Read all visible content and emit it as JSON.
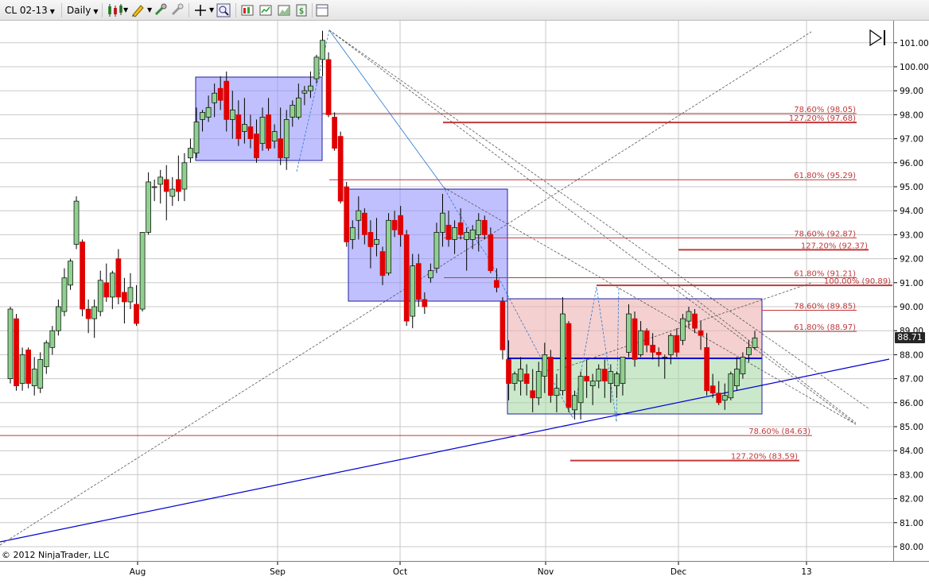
{
  "toolbar": {
    "instrument": "CL 02-13",
    "period": "Daily",
    "icons": [
      "candlestick-style-icon",
      "drawing-pencil-icon",
      "magnet-zoom-icon",
      "eraser-icon",
      "crosshair-icon",
      "zoom-icon",
      "data-box-icon",
      "chart-properties-icon",
      "strategy-icon",
      "template-icon"
    ]
  },
  "copyright": "© 2012 NinjaTrader, LLC",
  "last_price": "88.71",
  "colors": {
    "up_candle": "#8fd18f",
    "down_candle": "#e00000",
    "box_blue": "#8080ff",
    "box_red": "#f0a0a0",
    "box_green": "#a0d8a0",
    "fib_line": "#c0393b",
    "trend_blue": "#0000cc",
    "grid": "#c8c8c8"
  },
  "chart_data": {
    "type": "candlestick",
    "y_ticks": [
      "80.00",
      "81.00",
      "82.00",
      "83.00",
      "84.00",
      "85.00",
      "86.00",
      "87.00",
      "88.00",
      "89.00",
      "90.00",
      "91.00",
      "92.00",
      "93.00",
      "94.00",
      "95.00",
      "96.00",
      "97.00",
      "98.00",
      "99.00",
      "100.00",
      "101.00"
    ],
    "x_labels": [
      "Aug",
      "Sep",
      "Oct",
      "Nov",
      "Dec",
      "13"
    ],
    "ylim": [
      79.7,
      101.7
    ],
    "fib_labels": [
      {
        "text": "78.60% (98.05)",
        "price": 98.05
      },
      {
        "text": "127.20% (97.68)",
        "price": 97.68
      },
      {
        "text": "61.80% (95.29)",
        "price": 95.29
      },
      {
        "text": "78.60% (92.87)",
        "price": 92.87
      },
      {
        "text": "127.20% (92.37)",
        "price": 92.37
      },
      {
        "text": "61.80% (91.21)",
        "price": 91.21
      },
      {
        "text": "100.00% (90.89)",
        "price": 90.89
      },
      {
        "text": "78.60% (89.85)",
        "price": 89.85
      },
      {
        "text": "61.80% (88.97)",
        "price": 88.97
      },
      {
        "text": "78.60% (84.63)",
        "price": 84.63
      },
      {
        "text": "127.20% (83.59)",
        "price": 83.59
      }
    ],
    "candles": [
      {
        "o": 87.0,
        "h": 90.0,
        "l": 86.8,
        "c": 89.9
      },
      {
        "o": 89.5,
        "h": 89.7,
        "l": 86.5,
        "c": 86.7
      },
      {
        "o": 86.8,
        "h": 88.3,
        "l": 86.5,
        "c": 88.0
      },
      {
        "o": 88.2,
        "h": 88.3,
        "l": 86.6,
        "c": 86.8
      },
      {
        "o": 86.7,
        "h": 87.9,
        "l": 86.3,
        "c": 87.4
      },
      {
        "o": 86.6,
        "h": 88.1,
        "l": 86.4,
        "c": 87.8
      },
      {
        "o": 87.5,
        "h": 88.6,
        "l": 87.2,
        "c": 88.5
      },
      {
        "o": 88.3,
        "h": 89.2,
        "l": 88.0,
        "c": 89.0
      },
      {
        "o": 89.0,
        "h": 90.3,
        "l": 88.8,
        "c": 90.0
      },
      {
        "o": 89.8,
        "h": 91.6,
        "l": 89.6,
        "c": 91.2
      },
      {
        "o": 90.9,
        "h": 92.0,
        "l": 90.7,
        "c": 91.9
      },
      {
        "o": 92.6,
        "h": 94.6,
        "l": 92.4,
        "c": 94.4
      },
      {
        "o": 92.7,
        "h": 92.8,
        "l": 89.6,
        "c": 89.9
      },
      {
        "o": 89.9,
        "h": 90.3,
        "l": 88.9,
        "c": 89.5
      },
      {
        "o": 89.5,
        "h": 90.3,
        "l": 88.7,
        "c": 90.0
      },
      {
        "o": 89.8,
        "h": 91.5,
        "l": 89.6,
        "c": 91.1
      },
      {
        "o": 91.0,
        "h": 91.8,
        "l": 90.2,
        "c": 90.4
      },
      {
        "o": 90.4,
        "h": 91.5,
        "l": 89.9,
        "c": 91.4
      },
      {
        "o": 92.0,
        "h": 92.4,
        "l": 90.1,
        "c": 90.4
      },
      {
        "o": 90.6,
        "h": 91.2,
        "l": 89.3,
        "c": 90.2
      },
      {
        "o": 90.2,
        "h": 91.4,
        "l": 89.9,
        "c": 90.8
      },
      {
        "o": 90.1,
        "h": 90.9,
        "l": 89.2,
        "c": 89.3
      },
      {
        "o": 89.9,
        "h": 93.1,
        "l": 89.8,
        "c": 93.1
      },
      {
        "o": 93.1,
        "h": 95.6,
        "l": 93.0,
        "c": 95.2
      },
      {
        "o": 95.0,
        "h": 95.3,
        "l": 94.4,
        "c": 95.0
      },
      {
        "o": 95.1,
        "h": 95.7,
        "l": 94.3,
        "c": 95.4
      },
      {
        "o": 95.3,
        "h": 95.9,
        "l": 93.6,
        "c": 94.8
      },
      {
        "o": 94.6,
        "h": 95.4,
        "l": 94.2,
        "c": 94.9
      },
      {
        "o": 95.3,
        "h": 96.3,
        "l": 94.4,
        "c": 94.8
      },
      {
        "o": 94.9,
        "h": 96.4,
        "l": 94.4,
        "c": 96.0
      },
      {
        "o": 96.2,
        "h": 97.0,
        "l": 96.0,
        "c": 96.6
      },
      {
        "o": 96.4,
        "h": 98.3,
        "l": 96.2,
        "c": 97.7
      },
      {
        "o": 97.8,
        "h": 98.2,
        "l": 97.3,
        "c": 98.1
      },
      {
        "o": 97.9,
        "h": 98.8,
        "l": 97.7,
        "c": 98.3
      },
      {
        "o": 98.5,
        "h": 99.3,
        "l": 97.9,
        "c": 98.9
      },
      {
        "o": 99.1,
        "h": 99.6,
        "l": 98.2,
        "c": 98.6
      },
      {
        "o": 99.4,
        "h": 99.8,
        "l": 97.3,
        "c": 97.8
      },
      {
        "o": 97.8,
        "h": 99.0,
        "l": 97.0,
        "c": 98.2
      },
      {
        "o": 98.0,
        "h": 98.6,
        "l": 96.7,
        "c": 97.0
      },
      {
        "o": 97.3,
        "h": 98.7,
        "l": 96.8,
        "c": 97.6
      },
      {
        "o": 97.5,
        "h": 98.0,
        "l": 96.6,
        "c": 97.0
      },
      {
        "o": 97.2,
        "h": 97.8,
        "l": 96.0,
        "c": 96.2
      },
      {
        "o": 96.8,
        "h": 98.3,
        "l": 96.5,
        "c": 97.9
      },
      {
        "o": 98.0,
        "h": 98.7,
        "l": 96.5,
        "c": 96.6
      },
      {
        "o": 96.9,
        "h": 97.6,
        "l": 96.6,
        "c": 97.3
      },
      {
        "o": 97.0,
        "h": 98.3,
        "l": 95.9,
        "c": 96.2
      },
      {
        "o": 96.2,
        "h": 98.2,
        "l": 95.7,
        "c": 97.8
      },
      {
        "o": 97.9,
        "h": 98.6,
        "l": 97.5,
        "c": 98.4
      },
      {
        "o": 97.9,
        "h": 99.3,
        "l": 97.8,
        "c": 98.7
      },
      {
        "o": 98.9,
        "h": 99.2,
        "l": 98.4,
        "c": 99.0
      },
      {
        "o": 99.0,
        "h": 99.8,
        "l": 98.7,
        "c": 99.2
      },
      {
        "o": 99.5,
        "h": 100.5,
        "l": 99.3,
        "c": 100.4
      },
      {
        "o": 100.3,
        "h": 101.5,
        "l": 99.6,
        "c": 101.1
      },
      {
        "o": 100.3,
        "h": 100.6,
        "l": 97.9,
        "c": 98.0
      },
      {
        "o": 97.9,
        "h": 98.1,
        "l": 96.5,
        "c": 96.6
      },
      {
        "o": 97.1,
        "h": 97.3,
        "l": 94.3,
        "c": 94.4
      },
      {
        "o": 95.0,
        "h": 95.2,
        "l": 92.5,
        "c": 92.7
      },
      {
        "o": 92.8,
        "h": 93.6,
        "l": 92.4,
        "c": 93.3
      },
      {
        "o": 93.6,
        "h": 94.6,
        "l": 92.8,
        "c": 94.0
      },
      {
        "o": 93.9,
        "h": 94.1,
        "l": 92.6,
        "c": 93.0
      },
      {
        "o": 93.1,
        "h": 93.6,
        "l": 91.6,
        "c": 92.5
      },
      {
        "o": 92.6,
        "h": 93.7,
        "l": 92.1,
        "c": 92.8
      },
      {
        "o": 92.3,
        "h": 92.5,
        "l": 90.9,
        "c": 91.3
      },
      {
        "o": 91.4,
        "h": 93.9,
        "l": 91.3,
        "c": 93.6
      },
      {
        "o": 93.6,
        "h": 94.0,
        "l": 92.9,
        "c": 93.2
      },
      {
        "o": 93.8,
        "h": 94.2,
        "l": 92.5,
        "c": 93.0
      },
      {
        "o": 93.0,
        "h": 93.2,
        "l": 89.2,
        "c": 89.4
      },
      {
        "o": 89.6,
        "h": 92.2,
        "l": 89.1,
        "c": 91.7
      },
      {
        "o": 91.8,
        "h": 92.2,
        "l": 90.0,
        "c": 90.3
      },
      {
        "o": 90.3,
        "h": 90.6,
        "l": 89.7,
        "c": 90.0
      },
      {
        "o": 91.2,
        "h": 91.8,
        "l": 91.0,
        "c": 91.5
      },
      {
        "o": 91.6,
        "h": 93.5,
        "l": 91.4,
        "c": 93.1
      },
      {
        "o": 93.1,
        "h": 94.7,
        "l": 92.5,
        "c": 93.9
      },
      {
        "o": 93.4,
        "h": 94.0,
        "l": 92.5,
        "c": 92.8
      },
      {
        "o": 92.8,
        "h": 93.6,
        "l": 92.2,
        "c": 93.3
      },
      {
        "o": 93.5,
        "h": 94.1,
        "l": 92.8,
        "c": 93.0
      },
      {
        "o": 92.8,
        "h": 93.3,
        "l": 91.5,
        "c": 93.1
      },
      {
        "o": 92.8,
        "h": 93.4,
        "l": 92.4,
        "c": 93.2
      },
      {
        "o": 93.0,
        "h": 93.9,
        "l": 92.3,
        "c": 93.6
      },
      {
        "o": 93.6,
        "h": 93.8,
        "l": 92.8,
        "c": 93.0
      },
      {
        "o": 93.0,
        "h": 93.3,
        "l": 91.4,
        "c": 91.5
      },
      {
        "o": 91.1,
        "h": 91.6,
        "l": 90.6,
        "c": 90.8
      },
      {
        "o": 90.2,
        "h": 90.4,
        "l": 87.8,
        "c": 88.2
      },
      {
        "o": 87.8,
        "h": 88.6,
        "l": 86.1,
        "c": 86.8
      },
      {
        "o": 86.8,
        "h": 87.3,
        "l": 86.5,
        "c": 87.2
      },
      {
        "o": 86.9,
        "h": 87.9,
        "l": 86.3,
        "c": 87.4
      },
      {
        "o": 87.2,
        "h": 87.6,
        "l": 86.3,
        "c": 86.8
      },
      {
        "o": 86.5,
        "h": 87.4,
        "l": 85.6,
        "c": 86.2
      },
      {
        "o": 86.2,
        "h": 87.7,
        "l": 85.9,
        "c": 87.3
      },
      {
        "o": 87.1,
        "h": 88.5,
        "l": 86.4,
        "c": 88.0
      },
      {
        "o": 87.9,
        "h": 88.2,
        "l": 86.0,
        "c": 86.3
      },
      {
        "o": 86.3,
        "h": 87.2,
        "l": 85.6,
        "c": 86.6
      },
      {
        "o": 86.5,
        "h": 90.4,
        "l": 86.3,
        "c": 89.7
      },
      {
        "o": 89.3,
        "h": 89.4,
        "l": 85.6,
        "c": 85.8
      },
      {
        "o": 85.7,
        "h": 86.5,
        "l": 85.3,
        "c": 86.3
      },
      {
        "o": 86.0,
        "h": 87.3,
        "l": 85.3,
        "c": 87.1
      },
      {
        "o": 87.1,
        "h": 87.8,
        "l": 86.2,
        "c": 86.9
      },
      {
        "o": 86.7,
        "h": 87.2,
        "l": 85.9,
        "c": 86.9
      },
      {
        "o": 86.9,
        "h": 87.6,
        "l": 86.6,
        "c": 87.4
      },
      {
        "o": 87.4,
        "h": 87.8,
        "l": 86.2,
        "c": 86.9
      },
      {
        "o": 86.8,
        "h": 87.6,
        "l": 86.0,
        "c": 87.3
      },
      {
        "o": 86.7,
        "h": 87.3,
        "l": 86.2,
        "c": 87.2
      },
      {
        "o": 86.8,
        "h": 87.7,
        "l": 86.3,
        "c": 87.9
      },
      {
        "o": 88.1,
        "h": 90.1,
        "l": 87.9,
        "c": 89.7
      },
      {
        "o": 89.5,
        "h": 89.8,
        "l": 87.5,
        "c": 87.8
      },
      {
        "o": 88.0,
        "h": 89.4,
        "l": 87.9,
        "c": 89.0
      },
      {
        "o": 89.0,
        "h": 89.1,
        "l": 88.1,
        "c": 88.4
      },
      {
        "o": 88.4,
        "h": 88.9,
        "l": 87.8,
        "c": 88.1
      },
      {
        "o": 88.1,
        "h": 88.3,
        "l": 87.5,
        "c": 88.0
      },
      {
        "o": 87.9,
        "h": 88.0,
        "l": 87.0,
        "c": 87.9
      },
      {
        "o": 88.0,
        "h": 88.9,
        "l": 87.6,
        "c": 88.8
      },
      {
        "o": 88.8,
        "h": 89.1,
        "l": 87.9,
        "c": 88.1
      },
      {
        "o": 88.6,
        "h": 89.7,
        "l": 88.4,
        "c": 89.5
      },
      {
        "o": 89.4,
        "h": 90.0,
        "l": 89.1,
        "c": 89.8
      },
      {
        "o": 89.7,
        "h": 89.9,
        "l": 88.9,
        "c": 89.1
      },
      {
        "o": 89.0,
        "h": 89.4,
        "l": 88.2,
        "c": 88.8
      },
      {
        "o": 88.3,
        "h": 88.9,
        "l": 86.3,
        "c": 86.5
      },
      {
        "o": 86.7,
        "h": 87.2,
        "l": 86.2,
        "c": 86.4
      },
      {
        "o": 86.4,
        "h": 86.9,
        "l": 85.9,
        "c": 86.0
      },
      {
        "o": 86.1,
        "h": 86.8,
        "l": 85.7,
        "c": 86.3
      },
      {
        "o": 86.2,
        "h": 87.3,
        "l": 86.1,
        "c": 87.2
      },
      {
        "o": 86.7,
        "h": 87.9,
        "l": 86.5,
        "c": 87.4
      },
      {
        "o": 87.2,
        "h": 88.1,
        "l": 87.0,
        "c": 87.9
      },
      {
        "o": 88.0,
        "h": 88.6,
        "l": 87.7,
        "c": 88.3
      },
      {
        "o": 88.3,
        "h": 89.0,
        "l": 88.2,
        "c": 88.7
      }
    ]
  }
}
